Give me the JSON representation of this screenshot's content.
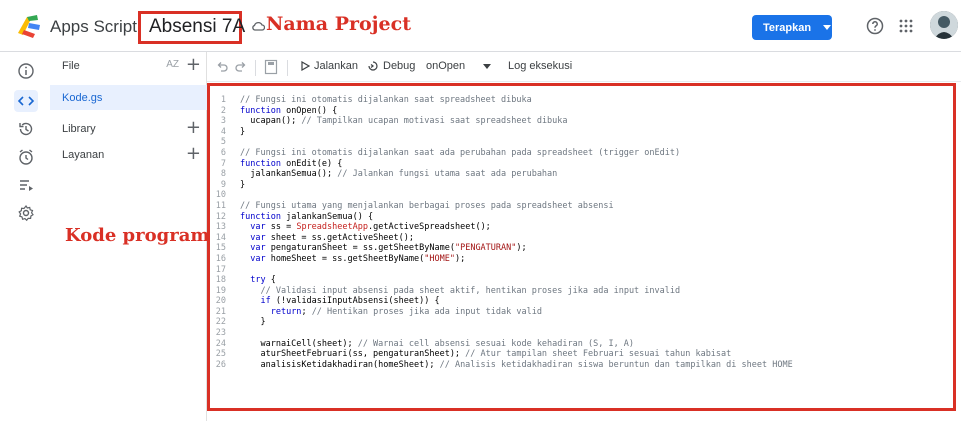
{
  "header": {
    "app_name": "Apps Script",
    "project_title": "Absensi 7A",
    "annotation_project": "Nama Project",
    "deploy_label": "Terapkan",
    "icons": [
      "apps-script-logo-icon",
      "cloud-icon",
      "help-icon",
      "apps-grid-icon",
      "avatar"
    ]
  },
  "colors": {
    "accent": "#1a73e8",
    "annotation": "#d93025",
    "active_bg": "#e8f0fe"
  },
  "rail": {
    "icons": [
      "info-icon",
      "code-icon",
      "history-icon",
      "triggers-icon",
      "executions-icon",
      "settings-icon"
    ]
  },
  "sidebar": {
    "files_label": "File",
    "sort_label": "AZ",
    "active_file": "Kode.gs",
    "library_label": "Library",
    "services_label": "Layanan",
    "annotation_code": "Kode program"
  },
  "toolbar": {
    "run_label": "Jalankan",
    "debug_label": "Debug",
    "function_label": "onOpen",
    "log_label": "Log eksekusi"
  },
  "code": [
    {
      "n": "1",
      "t": "// Fungsi ini otomatis dijalankan saat spreadsheet dibuka"
    },
    {
      "n": "2",
      "t": "function onOpen() {"
    },
    {
      "n": "3",
      "t": "  ucapan(); // Tampilkan ucapan motivasi saat spreadsheet dibuka"
    },
    {
      "n": "4",
      "t": "}"
    },
    {
      "n": "5",
      "t": ""
    },
    {
      "n": "6",
      "t": "// Fungsi ini otomatis dijalankan saat ada perubahan pada spreadsheet (trigger onEdit)"
    },
    {
      "n": "7",
      "t": "function onEdit(e) {"
    },
    {
      "n": "8",
      "t": "  jalankanSemua(); // Jalankan fungsi utama saat ada perubahan"
    },
    {
      "n": "9",
      "t": "}"
    },
    {
      "n": "10",
      "t": ""
    },
    {
      "n": "11",
      "t": "// Fungsi utama yang menjalankan berbagai proses pada spreadsheet absensi"
    },
    {
      "n": "12",
      "t": "function jalankanSemua() {"
    },
    {
      "n": "13",
      "t": "  var ss = SpreadsheetApp.getActiveSpreadsheet();"
    },
    {
      "n": "14",
      "t": "  var sheet = ss.getActiveSheet();"
    },
    {
      "n": "15",
      "t": "  var pengaturanSheet = ss.getSheetByName(\"PENGATURAN\");"
    },
    {
      "n": "16",
      "t": "  var homeSheet = ss.getSheetByName(\"HOME\");"
    },
    {
      "n": "17",
      "t": ""
    },
    {
      "n": "18",
      "t": "  try {"
    },
    {
      "n": "19",
      "t": "    // Validasi input absensi pada sheet aktif, hentikan proses jika ada input invalid"
    },
    {
      "n": "20",
      "t": "    if (!validasiInputAbsensi(sheet)) {"
    },
    {
      "n": "21",
      "t": "      return; // Hentikan proses jika ada input tidak valid"
    },
    {
      "n": "22",
      "t": "    }"
    },
    {
      "n": "23",
      "t": ""
    },
    {
      "n": "24",
      "t": "    warnaiCell(sheet); // Warnai cell absensi sesuai kode kehadiran (S, I, A)"
    },
    {
      "n": "25",
      "t": "    aturSheetFebruari(ss, pengaturanSheet); // Atur tampilan sheet Februari sesuai tahun kabisat"
    },
    {
      "n": "26",
      "t": "    analisisKetidakhadiran(homeSheet); // Analisis ketidakhadiran siswa beruntun dan tampilkan di sheet HOME"
    }
  ]
}
